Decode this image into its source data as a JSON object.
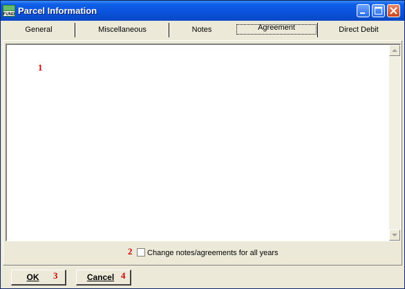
{
  "window": {
    "title": "Parcel Information",
    "app_icon_text": "FUND"
  },
  "tabs": [
    {
      "label": "General"
    },
    {
      "label": "Miscellaneous"
    },
    {
      "label": "Notes"
    },
    {
      "label": "Agreement",
      "active": true
    },
    {
      "label": "Direct Debit"
    }
  ],
  "agreement": {
    "memo_value": "",
    "checkbox_label": "Change notes/agreements for all years",
    "checkbox_checked": false
  },
  "buttons": {
    "ok_label": "OK",
    "cancel_label": "Cancel"
  },
  "markers": [
    "1",
    "2",
    "3",
    "4"
  ],
  "colors": {
    "title_bar": "#0a52db",
    "marker": "#cc0000",
    "dialog_bg": "#ece9d8"
  }
}
